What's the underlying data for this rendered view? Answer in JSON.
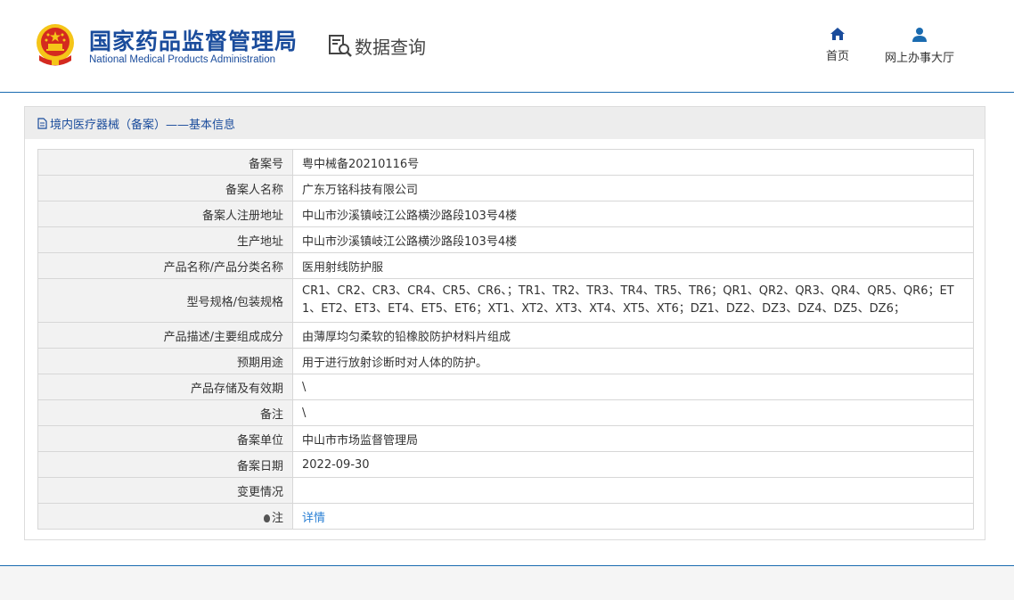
{
  "header": {
    "org_name_cn": "国家药品监督管理局",
    "org_name_en": "National Medical Products Administration",
    "data_query_label": "数据查询",
    "emblem_icon": "national-emblem-icon",
    "nav": [
      {
        "label": "首页",
        "icon": "home-icon"
      },
      {
        "label": "网上办事大厅",
        "icon": "user-icon"
      }
    ]
  },
  "panel": {
    "title": "境内医疗器械（备案）——基本信息",
    "title_icon": "document-icon"
  },
  "record": [
    {
      "label": "备案号",
      "value": "粤中械备20210116号"
    },
    {
      "label": "备案人名称",
      "value": "广东万铭科技有限公司"
    },
    {
      "label": "备案人注册地址",
      "value": "中山市沙溪镇岐江公路横沙路段103号4楼"
    },
    {
      "label": "生产地址",
      "value": "中山市沙溪镇岐江公路横沙路段103号4楼"
    },
    {
      "label": "产品名称/产品分类名称",
      "value": "医用射线防护服"
    },
    {
      "label": "型号规格/包装规格",
      "value": "CR1、CR2、CR3、CR4、CR5、CR6、；TR1、TR2、TR3、TR4、TR5、TR6；QR1、QR2、QR3、QR4、QR5、QR6；ET1、ET2、ET3、ET4、ET5、ET6；XT1、XT2、XT3、XT4、XT5、XT6；DZ1、DZ2、DZ3、DZ4、DZ5、DZ6；"
    },
    {
      "label": "产品描述/主要组成成分",
      "value": "由薄厚均匀柔软的铅橡胶防护材料片组成"
    },
    {
      "label": "预期用途",
      "value": "用于进行放射诊断时对人体的防护。"
    },
    {
      "label": "产品存储及有效期",
      "value": "\\"
    },
    {
      "label": "备注",
      "value": "\\"
    },
    {
      "label": "备案单位",
      "value": "中山市市场监督管理局"
    },
    {
      "label": "备案日期",
      "value": "2022-09-30"
    },
    {
      "label": "变更情况",
      "value": ""
    },
    {
      "label": "注",
      "value": "详情"
    }
  ],
  "colors": {
    "brand_blue": "#1a4c9c",
    "nav_blue": "#1a6bb0",
    "link_blue": "#2a7fd4",
    "emblem_red": "#d42a1f",
    "emblem_gold": "#f5c518"
  }
}
